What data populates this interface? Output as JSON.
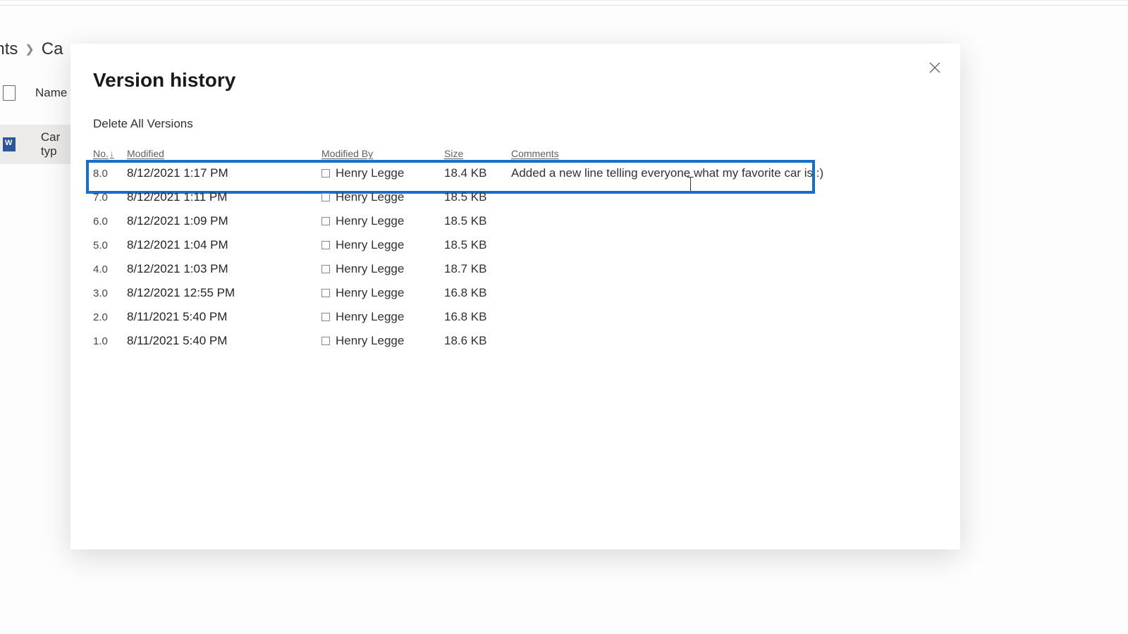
{
  "background": {
    "breadcrumb_prev": "ents",
    "breadcrumb_current": "Ca",
    "column_name": "Name",
    "file_name": "Car typ"
  },
  "modal": {
    "title": "Version history",
    "delete_all_label": "Delete All Versions",
    "columns": {
      "no": "No.",
      "modified": "Modified",
      "modified_by": "Modified By",
      "size": "Size",
      "comments": "Comments"
    },
    "versions": [
      {
        "no": "8.0",
        "modified": "8/12/2021 1:17 PM",
        "modified_by": "Henry Legge",
        "size": "18.4 KB",
        "comments_pre": "Added a new line telling everyone",
        "comments_post": " what my favorite car is :)",
        "highlighted": true,
        "has_cursor": true
      },
      {
        "no": "7.0",
        "modified": "8/12/2021 1:11 PM",
        "modified_by": "Henry Legge",
        "size": "18.5 KB",
        "comments_pre": "",
        "comments_post": ""
      },
      {
        "no": "6.0",
        "modified": "8/12/2021 1:09 PM",
        "modified_by": "Henry Legge",
        "size": "18.5 KB",
        "comments_pre": "",
        "comments_post": ""
      },
      {
        "no": "5.0",
        "modified": "8/12/2021 1:04 PM",
        "modified_by": "Henry Legge",
        "size": "18.5 KB",
        "comments_pre": "",
        "comments_post": ""
      },
      {
        "no": "4.0",
        "modified": "8/12/2021 1:03 PM",
        "modified_by": "Henry Legge",
        "size": "18.7 KB",
        "comments_pre": "",
        "comments_post": ""
      },
      {
        "no": "3.0",
        "modified": "8/12/2021 12:55 PM",
        "modified_by": "Henry Legge",
        "size": "16.8 KB",
        "comments_pre": "",
        "comments_post": ""
      },
      {
        "no": "2.0",
        "modified": "8/11/2021 5:40 PM",
        "modified_by": "Henry Legge",
        "size": "16.8 KB",
        "comments_pre": "",
        "comments_post": ""
      },
      {
        "no": "1.0",
        "modified": "8/11/2021 5:40 PM",
        "modified_by": "Henry Legge",
        "size": "18.6 KB",
        "comments_pre": "",
        "comments_post": ""
      }
    ]
  }
}
